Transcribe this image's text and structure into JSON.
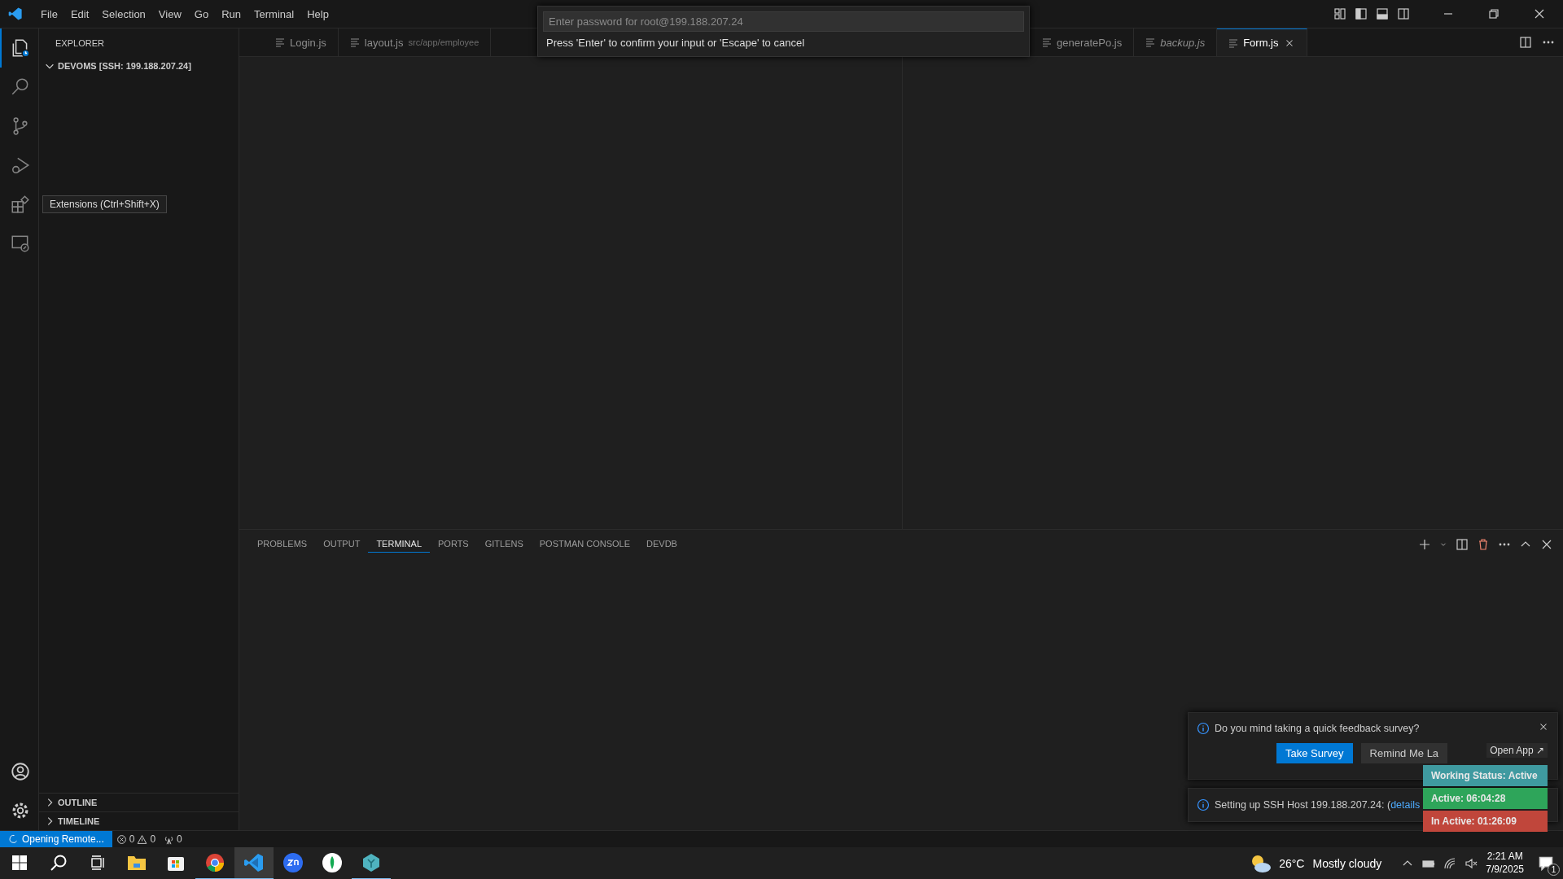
{
  "title_bar": {
    "menu": [
      "File",
      "Edit",
      "Selection",
      "View",
      "Go",
      "Run",
      "Terminal",
      "Help"
    ]
  },
  "quick_input": {
    "placeholder": "Enter password for root@199.188.207.24",
    "message": "Press 'Enter' to confirm your input or 'Escape' to cancel"
  },
  "activity_bar": [
    {
      "kind": "explorer",
      "selected": true
    },
    {
      "kind": "search",
      "selected": false
    },
    {
      "kind": "scm",
      "selected": false
    },
    {
      "kind": "debug",
      "selected": false
    },
    {
      "kind": "extensions",
      "selected": false
    },
    {
      "kind": "remote",
      "selected": false
    }
  ],
  "tooltip": "Extensions (Ctrl+Shift+X)",
  "sidebar": {
    "title": "EXPLORER",
    "folder": {
      "label": "DEVOMS [SSH: 199.188.207.24]",
      "expanded": true
    },
    "sections": [
      {
        "label": "OUTLINE",
        "expanded": false
      },
      {
        "label": "TIMELINE",
        "expanded": false
      }
    ]
  },
  "editor_tabs": [
    {
      "label": "Login.js",
      "selected": false,
      "preview": false
    },
    {
      "label": "layout.js",
      "description": "src/app/employee",
      "selected": false,
      "preview": false
    },
    {
      "label": "generatePo.js",
      "selected": false,
      "preview": false
    },
    {
      "label": "backup.js",
      "selected": false,
      "preview": true
    },
    {
      "label": "Form.js",
      "selected": true,
      "preview": false
    }
  ],
  "panel": {
    "tabs": [
      {
        "label": "PROBLEMS",
        "selected": false
      },
      {
        "label": "OUTPUT",
        "selected": false
      },
      {
        "label": "TERMINAL",
        "selected": true
      },
      {
        "label": "PORTS",
        "selected": false
      },
      {
        "label": "GITLENS",
        "selected": false
      },
      {
        "label": "POSTMAN CONSOLE",
        "selected": false
      },
      {
        "label": "DEVDB",
        "selected": false
      }
    ]
  },
  "notifications": [
    {
      "kind": "survey",
      "message": "Do you mind taking a quick feedback survey?",
      "buttons": [
        {
          "label": "Take Survey",
          "primary": true
        },
        {
          "label": "Remind Me La",
          "primary": false
        }
      ]
    },
    {
      "kind": "progress",
      "message": "Setting up SSH Host 199.188.207.24: (",
      "link": "details"
    }
  ],
  "status_widget": {
    "open_app": "Open App ↗",
    "rows": [
      {
        "label": "Working Status: Active",
        "color": "#3f9aa0"
      },
      {
        "label": "Active: 06:04:28",
        "color": "#2ea55a"
      },
      {
        "label": "In Active: 01:26:09",
        "color": "#c0463b"
      }
    ]
  },
  "status_bar": {
    "remote": "Opening Remote...",
    "errors": "0",
    "warnings": "0",
    "ports": "0"
  },
  "taskbar": {
    "apps": [
      {
        "kind": "explorer",
        "selected": false,
        "running": false
      },
      {
        "kind": "store",
        "selected": false,
        "running": false
      },
      {
        "kind": "chrome",
        "selected": false,
        "running": true
      },
      {
        "kind": "vscode",
        "selected": true,
        "running": true
      },
      {
        "kind": "zoom",
        "selected": false,
        "running": false
      },
      {
        "kind": "mongodb",
        "selected": false,
        "running": false
      },
      {
        "kind": "gem",
        "selected": false,
        "running": true
      }
    ],
    "weather": {
      "temperature": "26°C",
      "condition": "Mostly cloudy"
    },
    "time": "2:21 AM",
    "date": "7/9/2025",
    "notification_count": "1"
  }
}
